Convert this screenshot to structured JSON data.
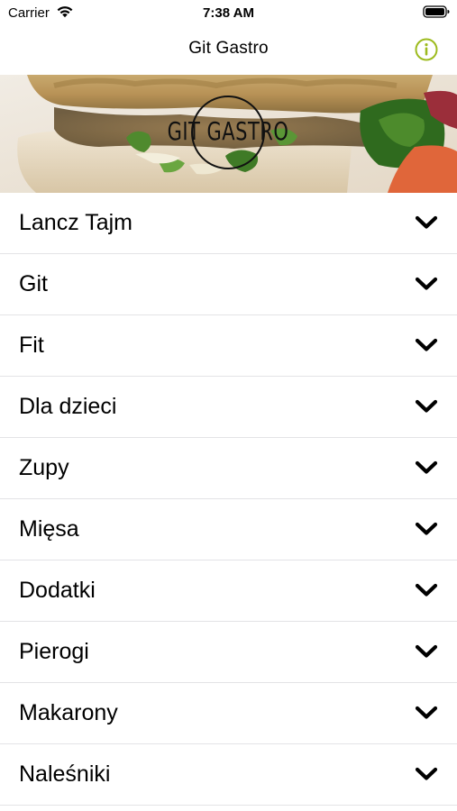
{
  "status_bar": {
    "carrier": "Carrier",
    "time": "7:38 AM"
  },
  "nav_bar": {
    "title": "Git Gastro",
    "info_icon": "info-circle-icon",
    "accent_color": "#9dbb1e"
  },
  "banner": {
    "logo_text": "GIT GASTRO"
  },
  "menu": {
    "chevron_icon": "chevron-down-icon",
    "items": [
      {
        "label": "Lancz Tajm"
      },
      {
        "label": "Git"
      },
      {
        "label": "Fit"
      },
      {
        "label": "Dla dzieci"
      },
      {
        "label": "Zupy"
      },
      {
        "label": "Mięsa"
      },
      {
        "label": "Dodatki"
      },
      {
        "label": "Pierogi"
      },
      {
        "label": "Makarony"
      },
      {
        "label": "Naleśniki"
      }
    ]
  }
}
